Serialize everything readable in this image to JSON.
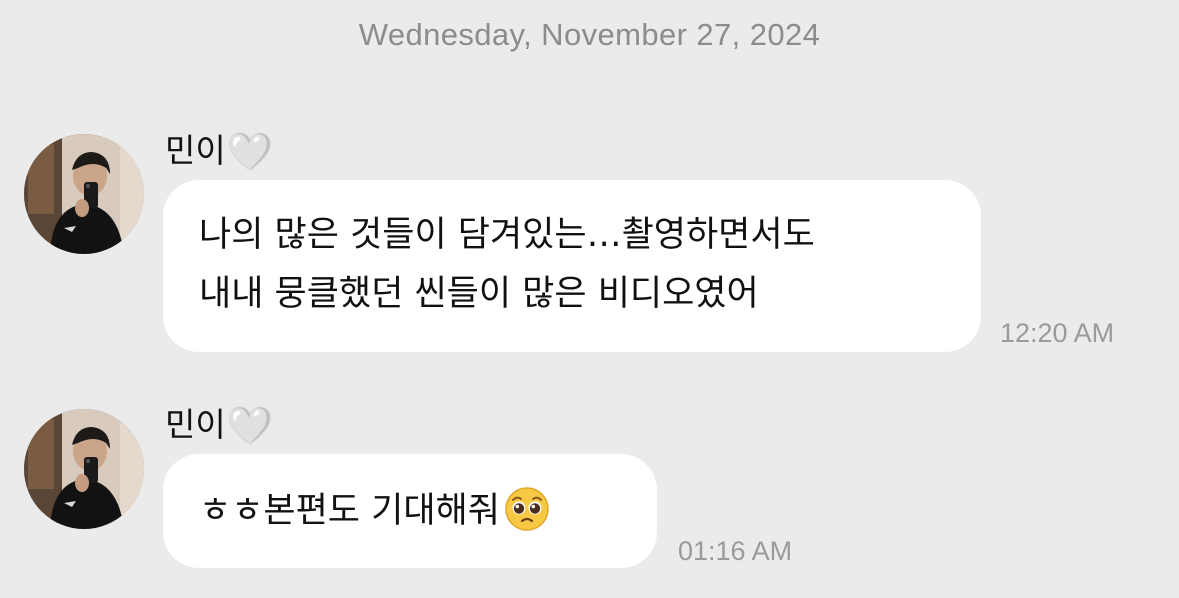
{
  "date_header": "Wednesday, November 27, 2024",
  "messages": [
    {
      "sender": "민이",
      "heart_icon": "🤍",
      "lines": [
        "나의 많은 것들이 담겨있는…촬영하면서도",
        "내내 뭉클했던 씬들이 많은 비디오였어"
      ],
      "time": "12:20 AM"
    },
    {
      "sender": "민이",
      "heart_icon": "🤍",
      "text": "ㅎㅎ본편도 기대해줘",
      "emoji": "pleading-face-icon",
      "time": "01:16 AM"
    }
  ],
  "colors": {
    "background": "#ebebeb",
    "bubble": "#ffffff",
    "timestamp": "#9a9a9a",
    "date_header": "#8c8c8c"
  }
}
